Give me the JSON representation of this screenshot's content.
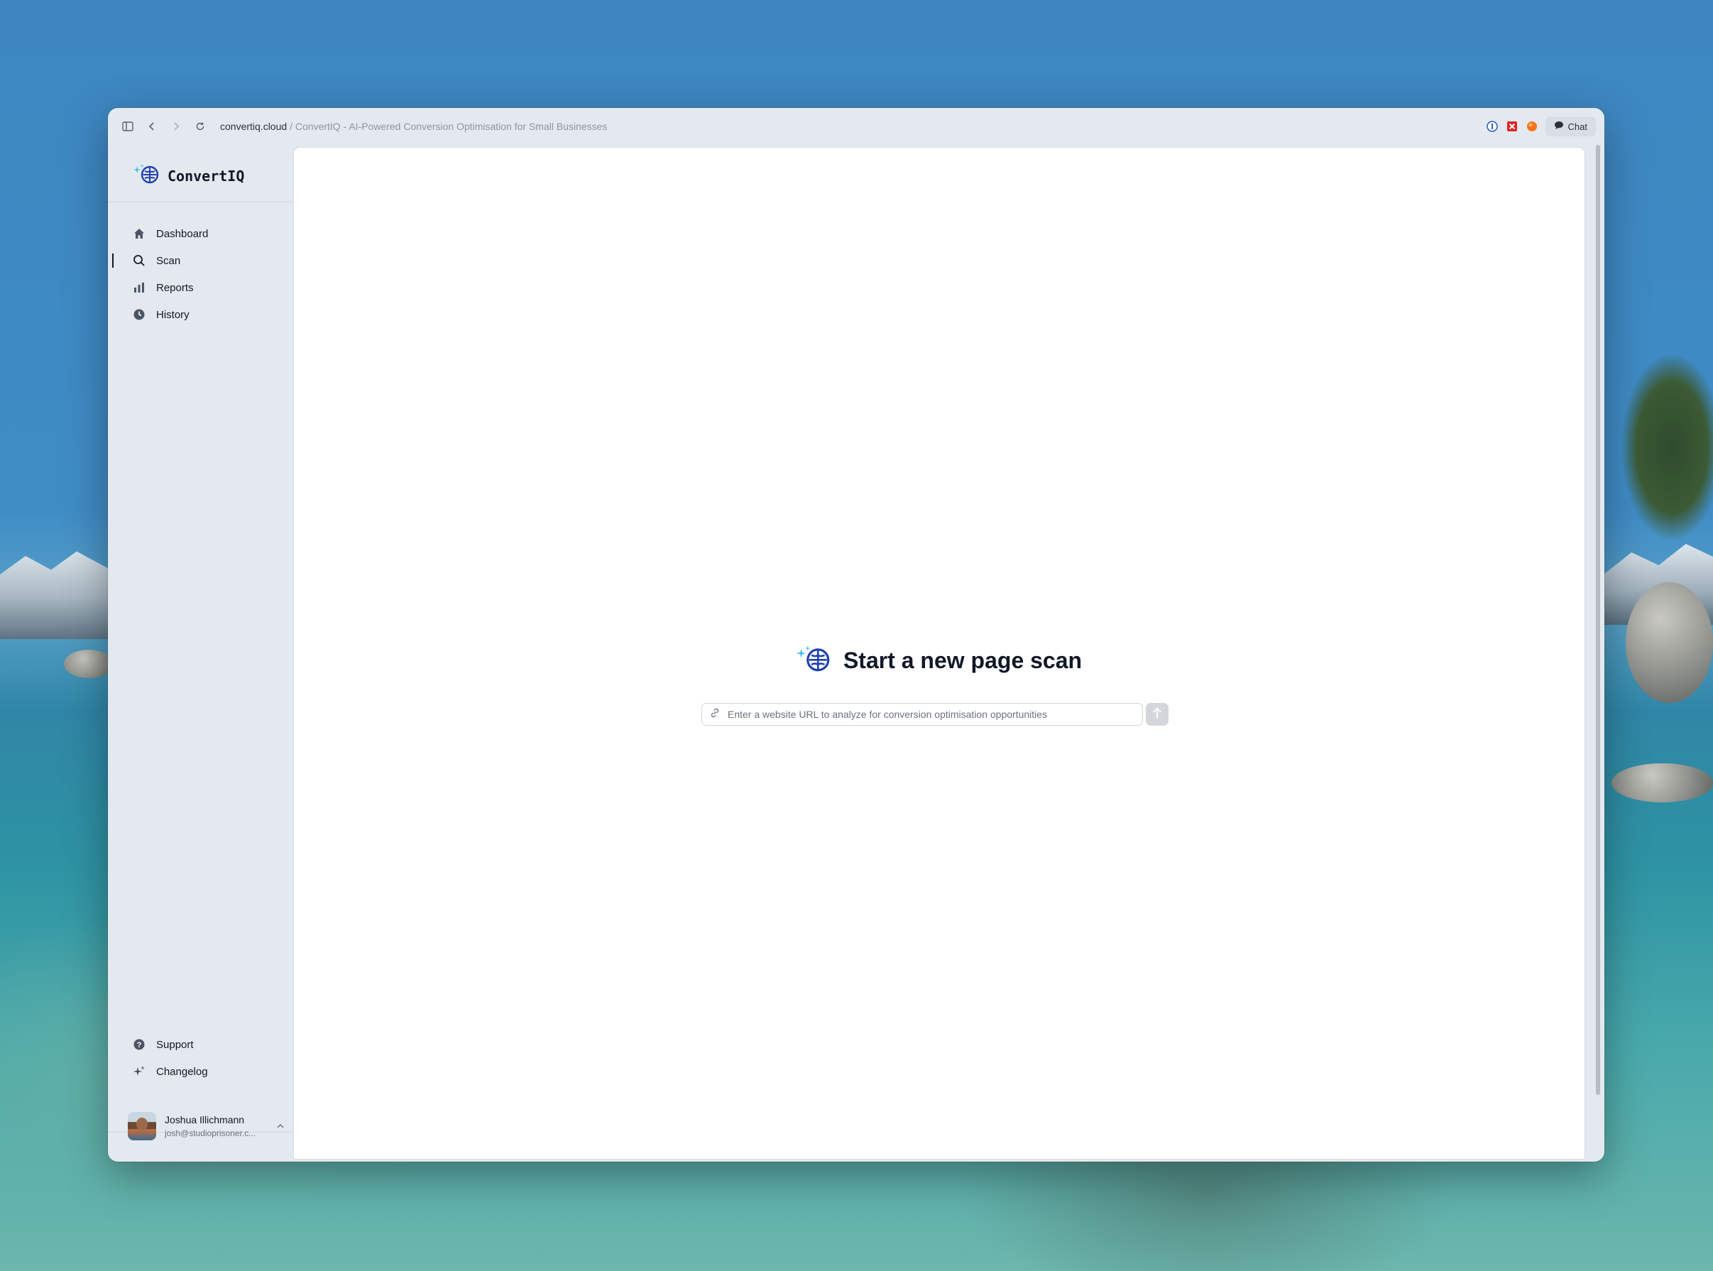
{
  "browser": {
    "url_domain": "convertiq.cloud",
    "url_separator": "/",
    "page_title": "ConvertIQ - AI-Powered Conversion Optimisation for Small Businesses",
    "chat_label": "Chat"
  },
  "brand": {
    "name": "ConvertIQ",
    "logo_icon": "brain-sparkle-icon"
  },
  "sidebar": {
    "nav": [
      {
        "label": "Dashboard",
        "icon": "home-icon",
        "active": false
      },
      {
        "label": "Scan",
        "icon": "search-icon",
        "active": true
      },
      {
        "label": "Reports",
        "icon": "bar-chart-icon",
        "active": false
      },
      {
        "label": "History",
        "icon": "clock-icon",
        "active": false
      }
    ],
    "footer": [
      {
        "label": "Support",
        "icon": "help-circle-icon"
      },
      {
        "label": "Changelog",
        "icon": "sparkles-icon"
      }
    ],
    "user": {
      "name": "Joshua Illichmann",
      "email": "josh@studioprisoner.c..."
    }
  },
  "main": {
    "title": "Start a new page scan",
    "search": {
      "placeholder": "Enter a website URL to analyze for conversion optimisation opportunities",
      "value": ""
    }
  },
  "colors": {
    "brand_blue": "#1e40af",
    "sparkle": "#38bdf8",
    "sidebar_bg": "#e4e9ef"
  }
}
